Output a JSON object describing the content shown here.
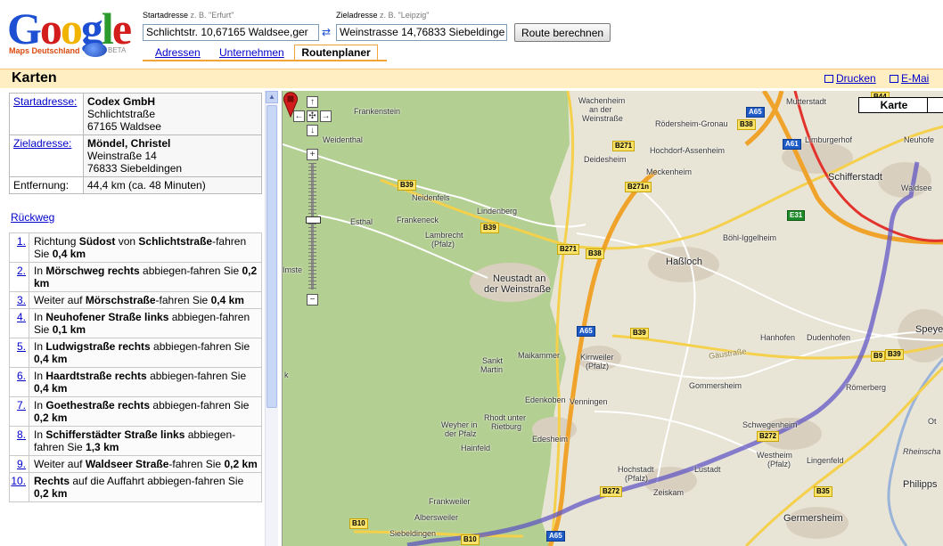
{
  "header": {
    "logo_text": "Google",
    "logo_sub": "Maps Deutschland",
    "logo_beta": "BETA",
    "start_label": "Startadresse",
    "start_hint": "z. B. \"Erfurt\"",
    "start_value": "Schlichtstr. 10,67165 Waldsee,ger",
    "dest_label": "Zieladresse",
    "dest_hint": "z. B. \"Leipzig\"",
    "dest_value": "Weinstrasse 14,76833 Siebeldinge",
    "swap_symbol": "⇄",
    "route_button": "Route berechnen",
    "tabs": [
      "Adressen",
      "Unternehmen",
      "Routenplaner"
    ]
  },
  "bar": {
    "title": "Karten",
    "print": "Drucken",
    "mail": "E-Mai"
  },
  "info": {
    "start_key": "Startadresse:",
    "start_name": "Codex GmbH",
    "start_street": "Schlichtstraße",
    "start_city": "67165 Waldsee",
    "dest_key": "Zieladresse:",
    "dest_name": "Möndel, Christel",
    "dest_street": "Weinstraße 14",
    "dest_city": "76833 Siebeldingen",
    "dist_key": "Entfernung:",
    "dist_value": "44,4 km (ca. 48 Minuten)"
  },
  "rueckweg": "Rückweg",
  "steps": [
    {
      "num": "1.",
      "pre": "Richtung ",
      "b1": "Südost",
      "mid": " von ",
      "b2": "Schlichtstraße",
      "post": "-fahren Sie ",
      "dist": "0,4 km"
    },
    {
      "num": "2.",
      "pre": "In ",
      "b1": "Mörschweg rechts",
      "mid": "",
      "b2": "",
      "post": " abbiegen-fahren Sie ",
      "dist": "0,2 km"
    },
    {
      "num": "3.",
      "pre": "Weiter auf ",
      "b1": "Mörschstraße",
      "mid": "",
      "b2": "",
      "post": "-fahren Sie ",
      "dist": "0,4 km"
    },
    {
      "num": "4.",
      "pre": "In ",
      "b1": "Neuhofener Straße links",
      "mid": "",
      "b2": "",
      "post": " abbiegen-fahren Sie ",
      "dist": "0,1 km"
    },
    {
      "num": "5.",
      "pre": "In ",
      "b1": "Ludwigstraße rechts",
      "mid": "",
      "b2": "",
      "post": " abbiegen-fahren Sie ",
      "dist": "0,4 km"
    },
    {
      "num": "6.",
      "pre": "In ",
      "b1": "Haardtstraße rechts",
      "mid": "",
      "b2": "",
      "post": " abbiegen-fahren Sie ",
      "dist": "0,4 km"
    },
    {
      "num": "7.",
      "pre": "In ",
      "b1": "Goethestraße rechts",
      "mid": "",
      "b2": "",
      "post": " abbiegen-fahren Sie ",
      "dist": "0,2 km"
    },
    {
      "num": "8.",
      "pre": "In ",
      "b1": "Schifferstädter Straße links",
      "mid": "",
      "b2": "",
      "post": " abbiegen-fahren Sie ",
      "dist": "1,3 km"
    },
    {
      "num": "9.",
      "pre": "Weiter auf ",
      "b1": "Waldseer Straße",
      "mid": "",
      "b2": "",
      "post": "-fahren Sie ",
      "dist": "0,2 km"
    },
    {
      "num": "10.",
      "pre": "",
      "b1": "Rechts",
      "mid": "",
      "b2": "",
      "post": " auf die Auffahrt abbiegen-fahren Sie ",
      "dist": "0,2 km"
    }
  ],
  "map": {
    "map_type_button": "Karte",
    "places": {
      "frankenstein": "Frankenstein",
      "weidenthal": "Weidenthal",
      "neidenfels": "Neidenfels",
      "esthal": "Esthal",
      "frankeneck": "Frankeneck",
      "lambrecht": "Lambrecht",
      "pfalz1": "(Pfalz)",
      "lindenberg": "Lindenberg",
      "imste": "Imste",
      "wachenheim": "Wachenheim",
      "an_der": "an der",
      "weinstrasse": "Weinstraße",
      "roedersheim": "Rödersheim-Gronau",
      "mutterstadt": "Mutterstadt",
      "limburgerhof": "Limburgerhof",
      "neuhofen": "Neuhofe",
      "deidesheim": "Deidesheim",
      "hochdorf": "Hochdorf-Assenheim",
      "meckenheim": "Meckenheim",
      "schifferstadt": "Schifferstadt",
      "waldsee": "Waldsee",
      "boehl": "Böhl-Iggelheim",
      "hassloch": "Haßloch",
      "neustadt1": "Neustadt an",
      "neustadt2": "der Weinstraße",
      "hanhofen": "Hanhofen",
      "dudenhofen": "Dudenhofen",
      "speyer": "Speyer",
      "gaeustrasse": "Gäustraße",
      "maikammer": "Maikammer",
      "sankt": "Sankt",
      "martin": "Martin",
      "kirrweiler": "Kirrweiler",
      "pfalz2": "(Pfalz)",
      "k": "k",
      "gommersheim": "Gommersheim",
      "roemerberg": "Römerberg",
      "edenkoben": "Edenkoben",
      "venningen": "Venningen",
      "rhodt1": "Rhodt unter",
      "rhodt2": "Rietburg",
      "weyher1": "Weyher in",
      "weyher2": "der Pfalz",
      "edesheim": "Edesheim",
      "hainfeld": "Hainfeld",
      "schwegenheim": "Schwegenheim",
      "westheim1": "Westheim",
      "westheim2": "(Pfalz)",
      "lingenfeld": "Lingenfeld",
      "rheinschanz": "Rheinscha",
      "ot": "Ot",
      "hochstadt1": "Hochstadt",
      "hochstadt2": "(Pfalz)",
      "lustadt": "Lustadt",
      "zeiskam": "Zeiskam",
      "philipps": "Philipps",
      "frankweiler": "Frankweiler",
      "albersweiler": "Albersweiler",
      "siebeldingen": "Siebeldingen",
      "germersheim": "Germersheim"
    },
    "shields": {
      "b39a": "B39",
      "b39b": "B39",
      "b39c": "B39",
      "b39d": "B39",
      "b271a": "B271",
      "b271b": "B271",
      "b271n": "B271n",
      "b38a": "B38",
      "b38b": "B38",
      "b44": "B44",
      "a65a": "A65",
      "a65b": "A65",
      "a65c": "A65",
      "a61": "A61",
      "e31": "E31",
      "b9": "B9",
      "b272a": "B272",
      "b272b": "B272",
      "b35": "B35",
      "b10a": "B10",
      "b10b": "B10"
    }
  }
}
